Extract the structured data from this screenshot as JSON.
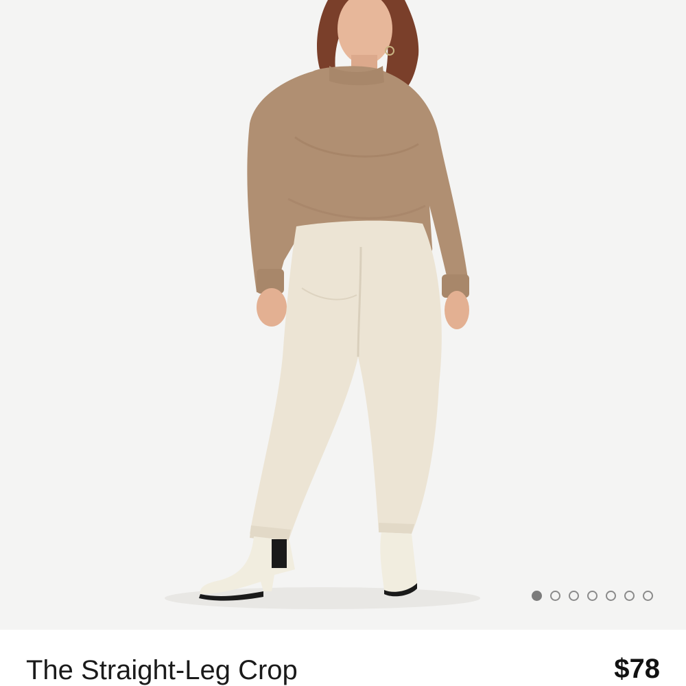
{
  "gallery": {
    "image_alt": "The Straight-Leg Crop",
    "dots": [
      {
        "active": true
      },
      {
        "active": false
      },
      {
        "active": false
      },
      {
        "active": false
      },
      {
        "active": false
      },
      {
        "active": false
      },
      {
        "active": false
      }
    ]
  },
  "product": {
    "title": "The Straight-Leg Crop",
    "price": "$78"
  },
  "colors": {
    "background": "#f4f4f3",
    "sweater": "#b08f72",
    "pants": "#ece4d4",
    "boots": "#f1eddf",
    "dot_active": "#7c7c7c"
  }
}
